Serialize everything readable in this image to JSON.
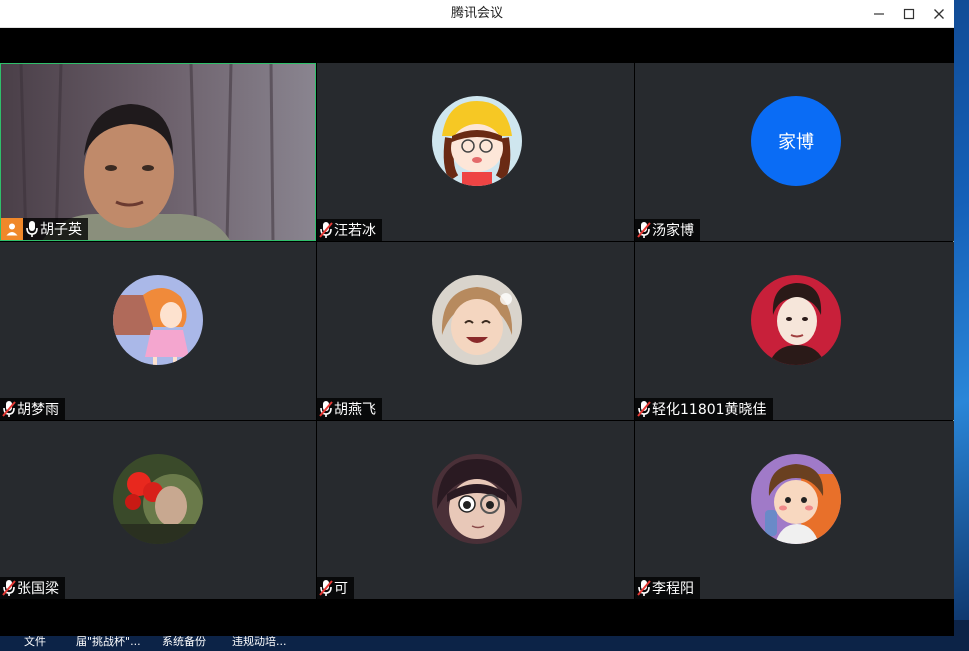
{
  "window": {
    "title": "腾讯会议",
    "controls": [
      "minimize-icon",
      "maximize-icon",
      "close-icon"
    ]
  },
  "participants": [
    {
      "name": "胡子英",
      "mic": "on",
      "host": true,
      "video": true,
      "avatar": "camera-video"
    },
    {
      "name": "汪若冰",
      "mic": "muted",
      "avatar": "cartoon-girl-yellow-hat"
    },
    {
      "name": "汤家博",
      "mic": "muted",
      "avatar_text": "家博",
      "avatar_color": "#0a6cf5"
    },
    {
      "name": "胡梦雨",
      "mic": "muted",
      "avatar": "cartoon-girl-pink-dress"
    },
    {
      "name": "胡燕飞",
      "mic": "muted",
      "avatar": "photo-child"
    },
    {
      "name": "轻化11801黄晓佳",
      "mic": "muted",
      "avatar": "illustrated-boy-red-bg"
    },
    {
      "name": "张国梁",
      "mic": "muted",
      "avatar": "photo-red-flowers"
    },
    {
      "name": "可",
      "mic": "muted",
      "avatar": "anime-boy-glasses"
    },
    {
      "name": "李程阳",
      "mic": "muted",
      "avatar": "cartoon-boy-bottle"
    }
  ],
  "taskbar_items": [
    "文件",
    "届\"挑战杯\"...",
    "系统备份",
    "违规动培..."
  ],
  "colors": {
    "tile_bg": "#272a2e",
    "active_border": "#2fbf6b",
    "host_badge": "#f0882a",
    "text_avatar": "#0a6cf5",
    "muted_mic": "#e53935"
  }
}
